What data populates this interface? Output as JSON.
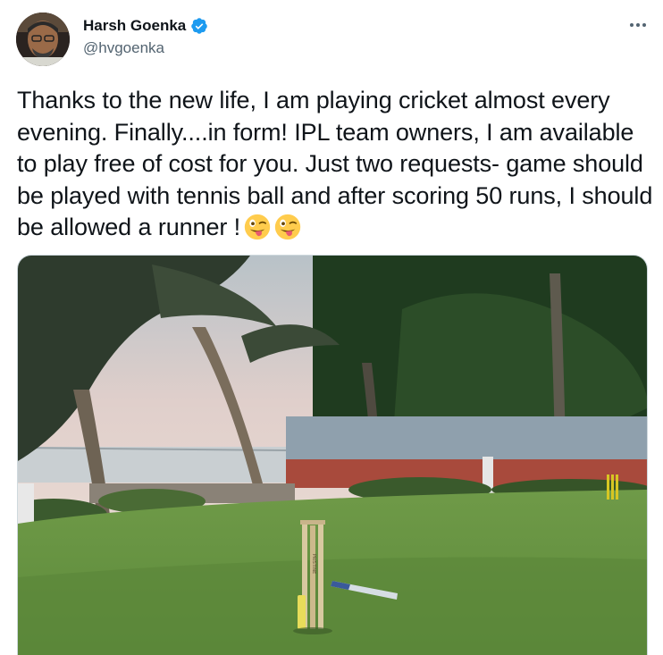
{
  "author": {
    "display_name": "Harsh Goenka",
    "handle": "@hvgoenka",
    "verified": true
  },
  "tweet": {
    "text": "Thanks to the new life, I am playing cricket almost every evening. Finally....in form! IPL team owners, I am available to play free of cost for you. Just two requests- game should be played with tennis ball and after scoring 50 runs, I should be allowed a runner !"
  },
  "media": {
    "stump_text": "PRISTINE"
  },
  "icons": {
    "verified": "verified-badge-icon",
    "more": "more-options-icon",
    "emoji": "winking-face-with-tongue-emoji"
  },
  "colors": {
    "verified_blue": "#1d9bf0",
    "handle_gray": "#536471",
    "text": "#0f1419",
    "border": "#cfd9de"
  }
}
